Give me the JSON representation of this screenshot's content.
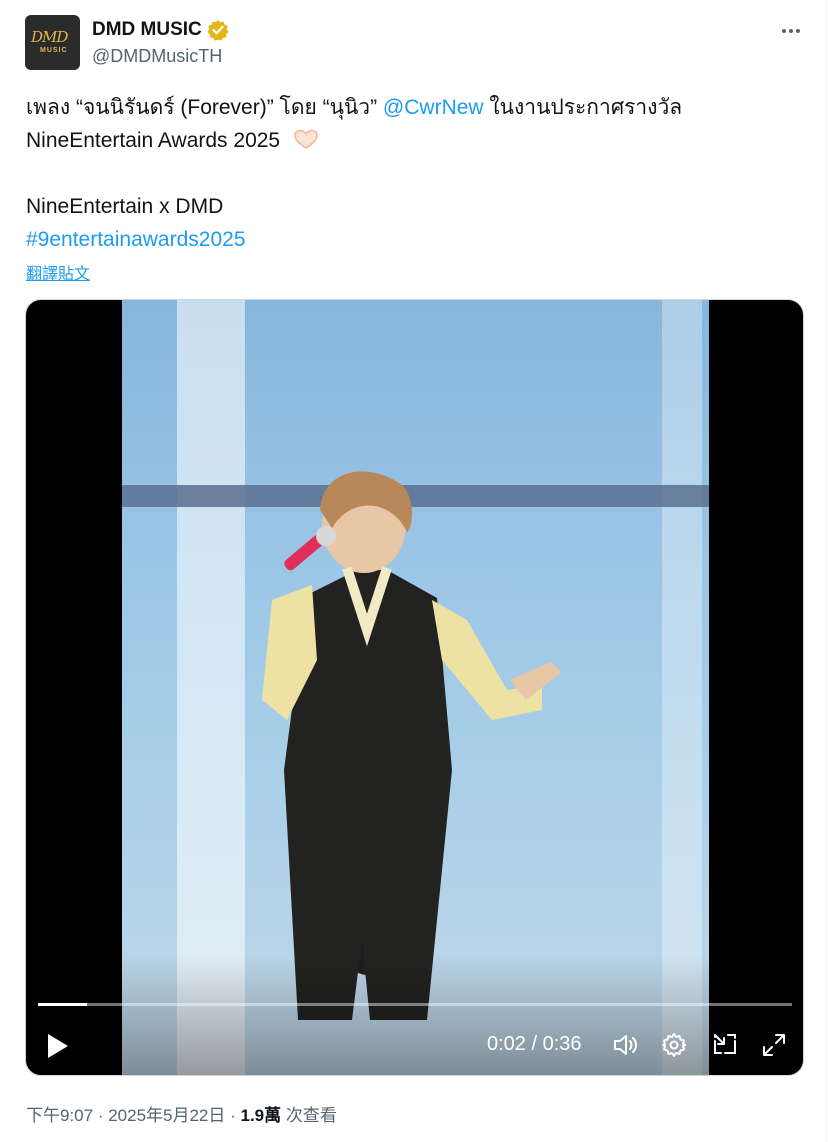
{
  "account": {
    "display_name": "DMD MUSIC",
    "handle": "@DMDMusicTH",
    "avatar_logo": "DMD",
    "avatar_sub": "MUSIC",
    "verified_color": "#e2b719"
  },
  "tweet": {
    "line1_a": "เพลง “จนนิรันดร์ (Forever)” โดย “นุนิว” ",
    "line1_mention": "@CwrNew",
    "line1_b": " ในงานประกาศรางวัล",
    "line2": "NineEntertain Awards 2025",
    "line3": "NineEntertain x DMD",
    "hashtag": "#9entertainawards2025",
    "translate_label": "翻譯貼文",
    "emoji": "heart-hands"
  },
  "video": {
    "current_time": "0:02",
    "separator": " / ",
    "duration": "0:36",
    "progress_fraction": 0.065
  },
  "meta": {
    "time": "下午9:07",
    "dot1": " · ",
    "date": "2025年5月22日",
    "dot2": " · ",
    "views_count": "1.9萬",
    "views_label": " 次查看"
  },
  "colors": {
    "link": "#1d9bf0",
    "secondary_text": "#536471",
    "primary_text": "#0f1419"
  }
}
